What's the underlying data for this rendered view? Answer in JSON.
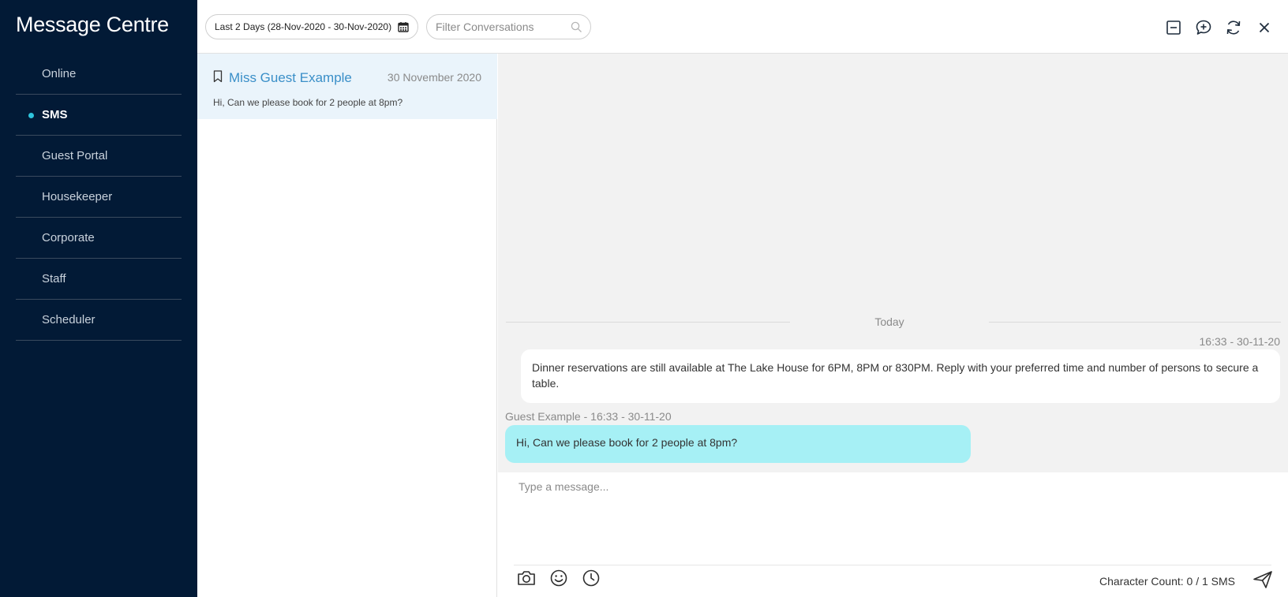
{
  "app": {
    "title": "Message Centre"
  },
  "sidebar": {
    "items": [
      {
        "label": "Online",
        "active": false
      },
      {
        "label": "SMS",
        "active": true
      },
      {
        "label": "Guest Portal",
        "active": false
      },
      {
        "label": "Housekeeper",
        "active": false
      },
      {
        "label": "Corporate",
        "active": false
      },
      {
        "label": "Staff",
        "active": false
      },
      {
        "label": "Scheduler",
        "active": false
      }
    ]
  },
  "toolbar": {
    "date_range": "Last 2 Days (28-Nov-2020 - 30-Nov-2020)",
    "filter_placeholder": "Filter Conversations",
    "icons": [
      "minimize-icon",
      "new-message-icon",
      "refresh-icon",
      "close-icon"
    ]
  },
  "conversations": [
    {
      "name": "Miss Guest Example",
      "date": "30 November 2020",
      "preview": "Hi, Can we please book for 2 people at 8pm?",
      "selected": true
    }
  ],
  "chat": {
    "day_label": "Today",
    "messages": [
      {
        "direction": "outgoing",
        "meta": "16:33 - 30-11-20",
        "text": "Dinner reservations are still available at The Lake House for 6PM, 8PM or 830PM. Reply with your preferred time and number of persons to secure a table."
      },
      {
        "direction": "incoming",
        "meta": "Guest Example - 16:33 - 30-11-20",
        "text": "Hi, Can we please book for 2 people at 8pm?"
      }
    ]
  },
  "composer": {
    "placeholder": "Type a message...",
    "char_count": "Character Count: 0 / 1 SMS",
    "icons": [
      "camera-icon",
      "emoji-icon",
      "clock-icon",
      "send-icon"
    ]
  },
  "colors": {
    "sidebar_bg": "#021a36",
    "accent_dot": "#2ec4dc",
    "link": "#3a8fc8",
    "incoming_bubble": "#a6f0f5",
    "selected_row": "#eaf4fb"
  }
}
